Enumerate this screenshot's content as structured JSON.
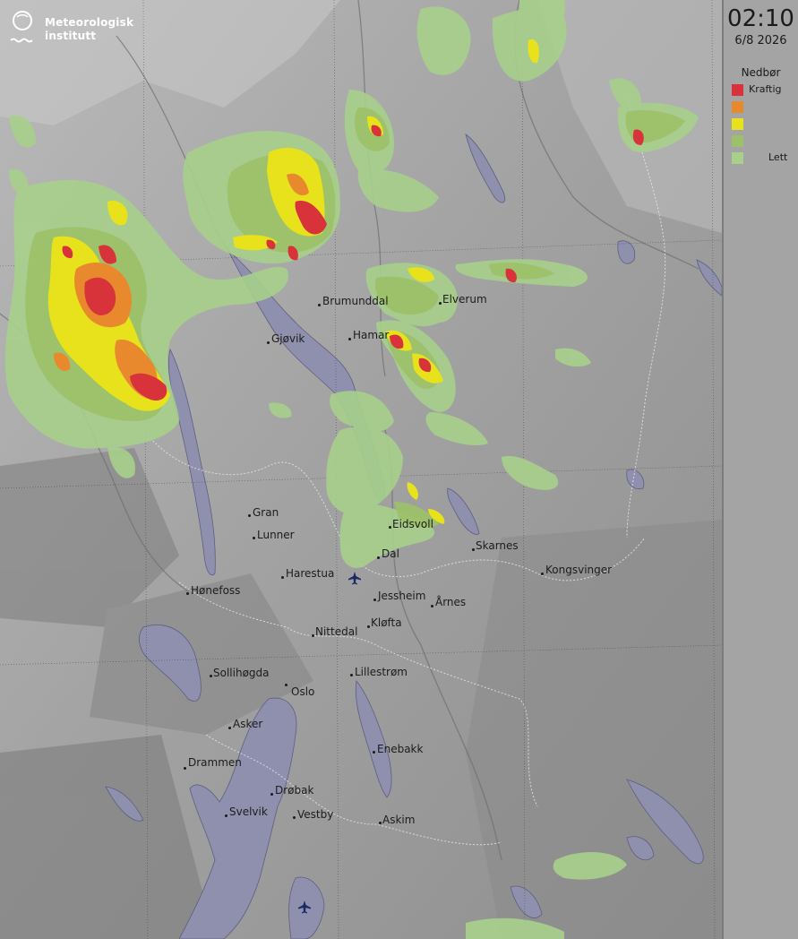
{
  "brand": {
    "line1": "Meteorologisk",
    "line2": "institutt"
  },
  "time": "02:10",
  "date": "6/8 2026",
  "legend": {
    "title": "Nedbør",
    "items": [
      {
        "label": "Kraftig",
        "color": "#d8323a"
      },
      {
        "label": "",
        "color": "#e7892c"
      },
      {
        "label": "",
        "color": "#e7e21c"
      },
      {
        "label": "",
        "color": "#9dc16a"
      },
      {
        "label": "Lett",
        "color": "#a7d08b"
      }
    ]
  },
  "colors": {
    "water": "#8f8fae",
    "land_dark": "#828282",
    "land_light": "#b8b8b8"
  },
  "places": [
    "Brumunddal",
    "Elverum",
    "Gjøvik",
    "Hamar",
    "Gran",
    "Eidsvoll",
    "Lunner",
    "Skarnes",
    "Dal",
    "Harestua",
    "Kongsvinger",
    "Hønefoss",
    "Jessheim",
    "Årnes",
    "Nittedal",
    "Kløfta",
    "Sollihøgda",
    "Lillestrøm",
    "Oslo",
    "Asker",
    "Enebakk",
    "Drammen",
    "Drøbak",
    "Svelvik",
    "Vestby",
    "Askim"
  ]
}
